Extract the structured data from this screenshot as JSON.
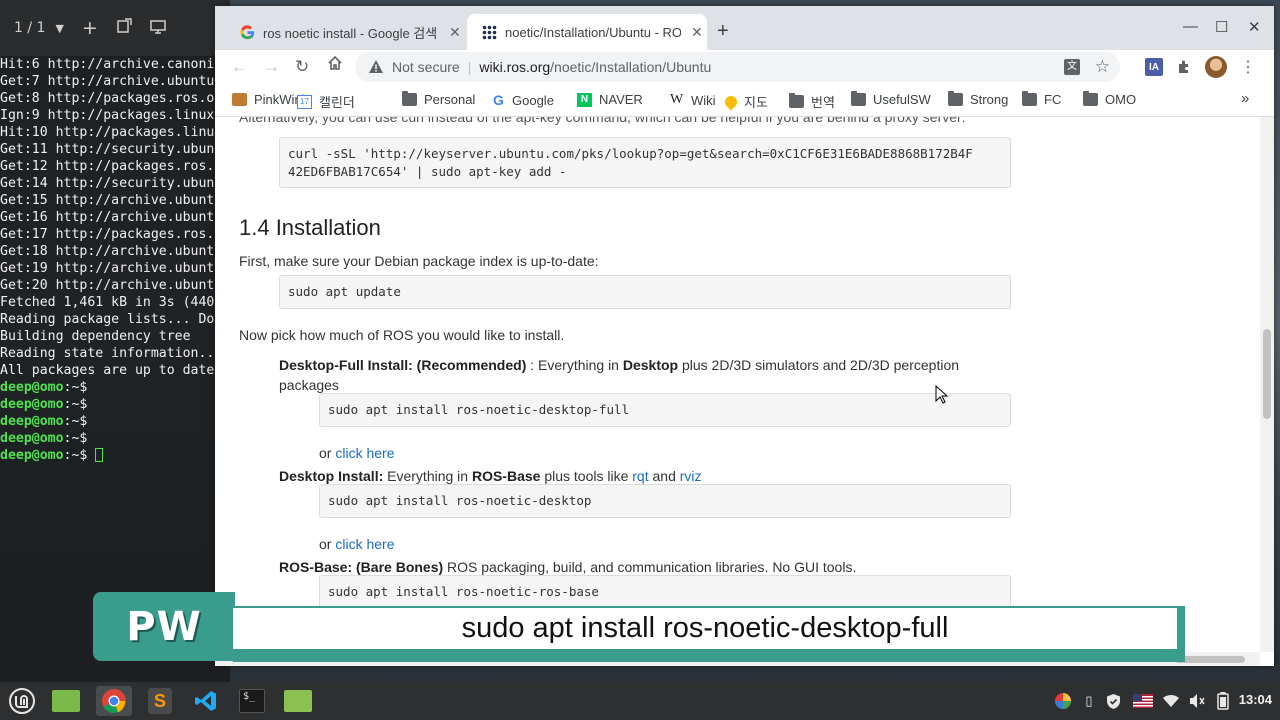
{
  "terminal": {
    "page_indicator": "1 / 1",
    "lines": [
      "Hit:6 http://archive.canoni",
      "Get:7 http://archive.ubuntu",
      "Get:8 http://packages.ros.o",
      "Ign:9 http://packages.linux",
      "Hit:10 http://packages.linu",
      "Get:11 http://security.ubun",
      "Get:12 http://packages.ros.",
      "Get:14 http://security.ubun",
      "Get:15 http://archive.ubunt",
      "Get:16 http://archive.ubunt",
      "Get:17 http://packages.ros.",
      "Get:18 http://archive.ubunt",
      "Get:19 http://archive.ubunt",
      "Get:20 http://archive.ubunt",
      "Fetched 1,461 kB in 3s (440",
      "Reading package lists... Do",
      "Building dependency tree",
      "Reading state information..",
      "All packages are up to date"
    ],
    "prompt_user": "deep@omo",
    "prompt_path": ":~$"
  },
  "browser": {
    "tabs": [
      {
        "title": "ros noetic install - Google 검색",
        "favicon": "google-icon",
        "active": false
      },
      {
        "title": "noetic/Installation/Ubuntu - ROS Wiki",
        "favicon": "ros-icon",
        "active": true
      }
    ],
    "not_secure": "Not secure",
    "url_host": "wiki.ros.org",
    "url_path": "/noetic/Installation/Ubuntu",
    "bookmarks": [
      {
        "label": "PinkWink",
        "icon": "pinkwink-icon"
      },
      {
        "label": "캘린더",
        "icon": "calendar-icon"
      },
      {
        "label": "Personal",
        "icon": "folder-icon"
      },
      {
        "label": "Google",
        "icon": "google-icon"
      },
      {
        "label": "NAVER",
        "icon": "naver-icon"
      },
      {
        "label": "Wiki",
        "icon": "wikipedia-icon"
      },
      {
        "label": "지도",
        "icon": "maps-icon"
      },
      {
        "label": "번역",
        "icon": "folder-icon"
      },
      {
        "label": "UsefulSW",
        "icon": "folder-icon"
      },
      {
        "label": "Strong",
        "icon": "folder-icon"
      },
      {
        "label": "FC",
        "icon": "folder-icon"
      },
      {
        "label": "OMO",
        "icon": "folder-icon"
      }
    ],
    "more_bookmarks": "»"
  },
  "page": {
    "cut_text": "Alternatively, you can use curl instead of the apt-key command, which can be helpful if you are behind a proxy server:",
    "curl_cmd_1": "curl -sSL 'http://keyserver.ubuntu.com/pks/lookup?op=get&search=0xC1CF6E31E6BADE8868B172B4F",
    "curl_cmd_2": "42ED6FBAB17C654' | sudo apt-key add -",
    "section_heading": "1.4 Installation",
    "first_text": "First, make sure your Debian package index is up-to-date:",
    "update_cmd": "sudo apt update",
    "pick_text": "Now pick how much of ROS you would like to install.",
    "desktop_full": {
      "label": "Desktop-Full Install: (Recommended)",
      "text_a": " : Everything in ",
      "bold": "Desktop",
      "text_b": " plus 2D/3D simulators and 2D/3D perception",
      "text_c": "packages",
      "cmd": "sudo apt install ros-noetic-desktop-full"
    },
    "or": "or ",
    "click_here": "click here",
    "desktop": {
      "label": "Desktop Install:",
      "text_a": " Everything in ",
      "bold": "ROS-Base",
      "text_b": " plus tools like ",
      "link1": "rqt",
      "and": " and ",
      "link2": "rviz",
      "cmd": "sudo apt install ros-noetic-desktop"
    },
    "ros_base": {
      "label": "ROS-Base: (Bare Bones)",
      "text": " ROS packaging, build, and communication libraries. No GUI tools.",
      "cmd": "sudo apt install ros-noetic-ros-base"
    }
  },
  "overlay": {
    "logo": "PW",
    "subtitle": "sudo apt install ros-noetic-desktop-full"
  },
  "taskbar": {
    "clock": "13:04"
  }
}
